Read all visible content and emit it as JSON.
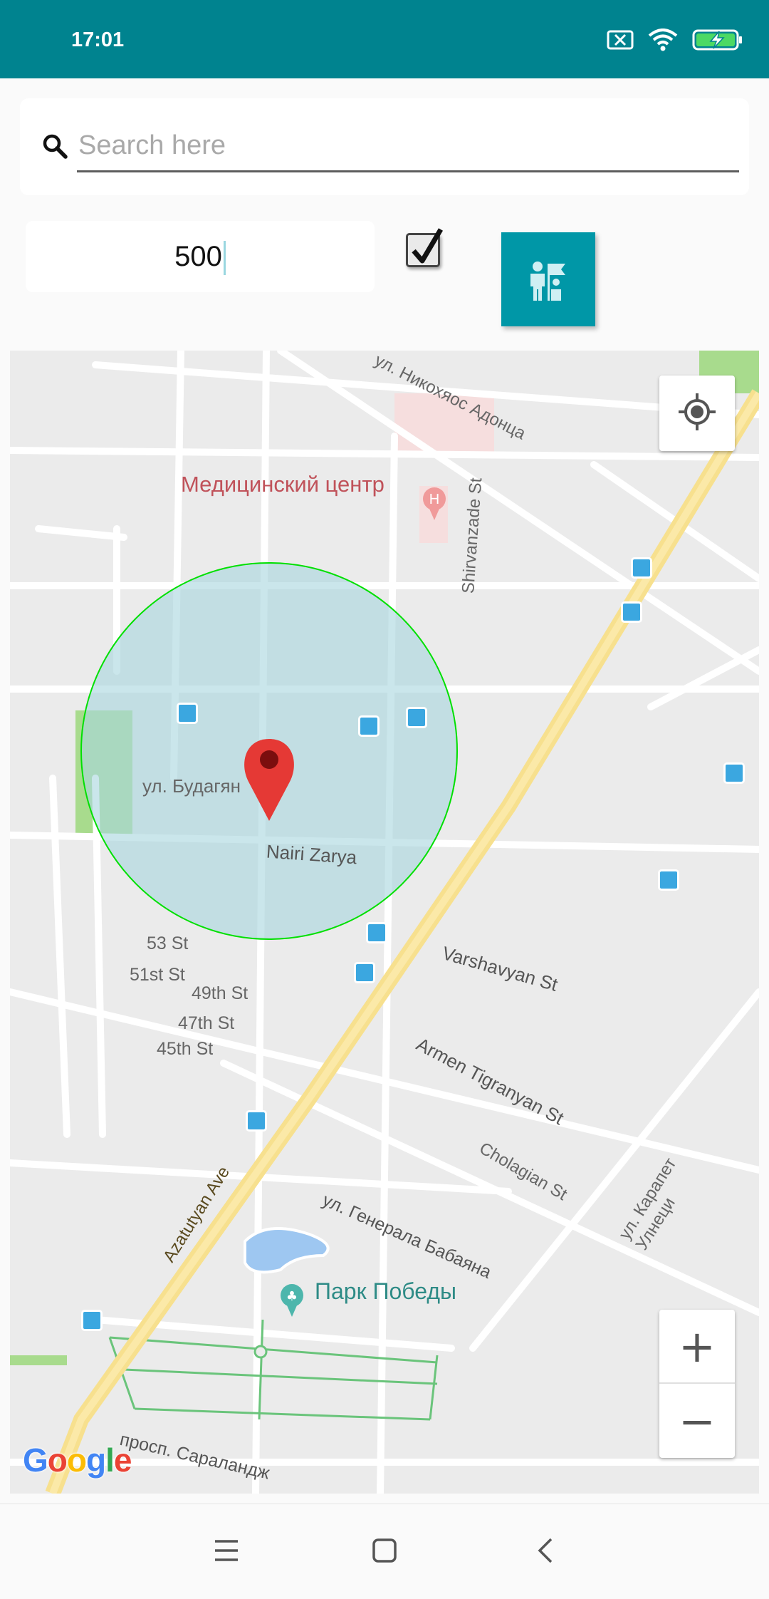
{
  "status_bar": {
    "time": "17:01",
    "icons": [
      "sim-blocked-icon",
      "wifi-icon",
      "battery-charging-icon"
    ],
    "color": "#00838f"
  },
  "search": {
    "placeholder": "Search here",
    "value": "",
    "icon": "search-icon"
  },
  "controls": {
    "radius_value": "500",
    "checkbox_checked": true,
    "action_button_icon": "tourist-guide-flag-icon",
    "accent_color": "#0097a7"
  },
  "map": {
    "labels": {
      "medical_center": "Медицинский центр",
      "nikokhyas_street": "ул. Никохяос Адонца",
      "shirvanzade": "Shirvanzade St",
      "budagyan": "ул. Будагян",
      "nairi": "Nairi Zarya",
      "st53": "53 St",
      "st51": "51st St",
      "st49": "49th St",
      "st47": "47th St",
      "st45": "45th St",
      "varshavyan": "Varshavyan St",
      "tigranyan": "Armen Tigranyan St",
      "cholagian": "Cholagian St",
      "karapet": "ул. Карапет Улнеци",
      "azatutyan": "Azatutyan Ave",
      "babayana": "ул. Генерала Бабаяна",
      "park": "Парк Победы",
      "saralandzh": "просп. Сараландж"
    },
    "google_logo": "Google",
    "circle_fill": "#b0dbe3",
    "circle_stroke": "#00e000",
    "marker_color": "#e53935",
    "zoom_in": "+",
    "zoom_out": "−",
    "locate_icon": "my-location-icon",
    "bus_stop_icon": "bus-stop-icon"
  },
  "nav_bar": {
    "icons": [
      "menu-icon",
      "home-square-icon",
      "back-chevron-icon"
    ]
  }
}
